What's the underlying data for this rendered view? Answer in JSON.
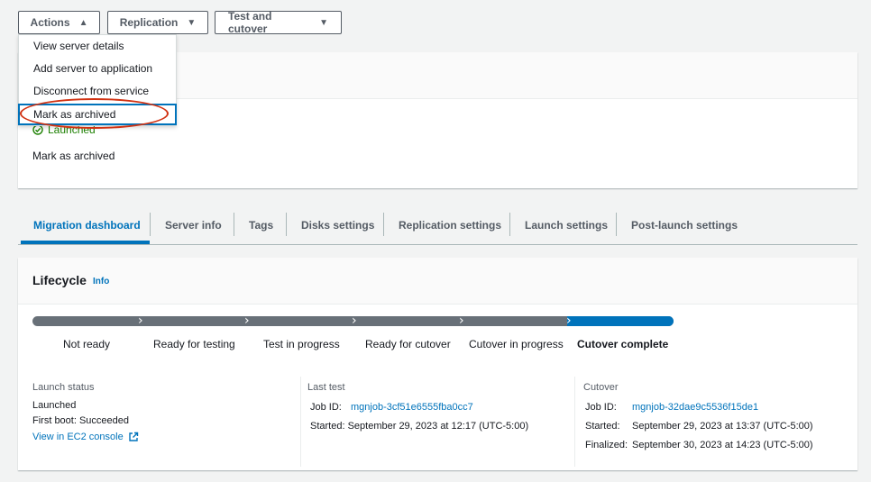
{
  "toolbar": {
    "actions_label": "Actions",
    "replication_label": "Replication",
    "test_cutover_label": "Test and cutover"
  },
  "actions_menu": {
    "items": [
      "View server details",
      "Add server to application",
      "Disconnect from service",
      "Mark as archived"
    ],
    "selected_index": 3
  },
  "server_summary": {
    "status": "Launched",
    "archive_text": "Mark as archived"
  },
  "tabs": [
    {
      "label": "Migration dashboard",
      "active": true
    },
    {
      "label": "Server info",
      "active": false
    },
    {
      "label": "Tags",
      "active": false
    },
    {
      "label": "Disks settings",
      "active": false
    },
    {
      "label": "Replication settings",
      "active": false
    },
    {
      "label": "Launch settings",
      "active": false
    },
    {
      "label": "Post-launch settings",
      "active": false
    }
  ],
  "lifecycle": {
    "title": "Lifecycle",
    "info_label": "Info",
    "steps": [
      "Not ready",
      "Ready for testing",
      "Test in progress",
      "Ready for cutover",
      "Cutover in progress",
      "Cutover complete"
    ],
    "current_step_index": 5
  },
  "launch_status": {
    "heading": "Launch status",
    "status": "Launched",
    "first_boot": "First boot: Succeeded",
    "ec2_link": "View in EC2 console"
  },
  "last_test": {
    "heading": "Last test",
    "job_id_label": "Job ID:",
    "job_id": "mgnjob-3cf51e6555fba0cc7",
    "started": "Started: September 29, 2023 at 12:17 (UTC-5:00)"
  },
  "cutover": {
    "heading": "Cutover",
    "job_id_label": "Job ID:",
    "job_id": "mgnjob-32dae9c5536f15de1",
    "started_label": "Started:",
    "started": "September 29, 2023 at 13:37 (UTC-5:00)",
    "finalized_label": "Finalized:",
    "finalized": "September 30, 2023 at 14:23 (UTC-5:00)"
  },
  "colors": {
    "accent": "#0073bb",
    "success": "#1d8102",
    "annotation": "#d13212"
  }
}
